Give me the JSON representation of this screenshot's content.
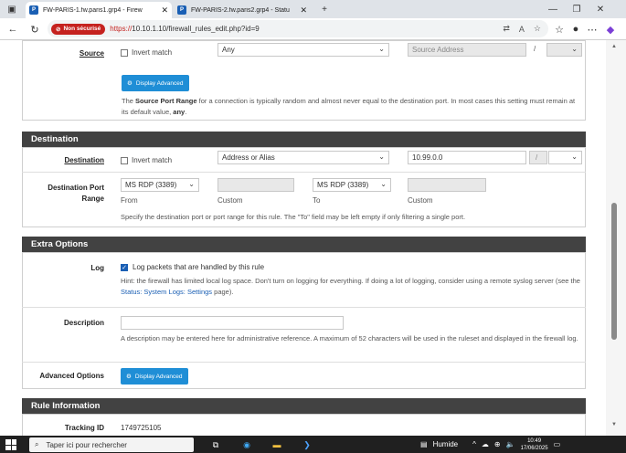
{
  "browser": {
    "tabs": [
      {
        "title": "FW-PARIS-1.fw.paris1.grp4 - Firew",
        "active": true
      },
      {
        "title": "FW-PARIS-2.fw.paris2.grp4 - Statu",
        "active": false
      }
    ],
    "new_tab": "+",
    "security_badge": "Non sécurisé",
    "url_scheme": "https://",
    "url_rest": "10.10.1.10/firewall_rules_edit.php?id=9"
  },
  "source": {
    "label": "Source",
    "invert_label": "Invert match",
    "type_value": "Any",
    "address_placeholder": "Source Address",
    "slash": "/",
    "advanced_button": "Display Advanced",
    "help_pre": "The ",
    "help_bold": "Source Port Range",
    "help_mid": " for a connection is typically random and almost never equal to the destination port. In most cases this setting must remain at its default value, ",
    "help_bold2": "any",
    "help_end": "."
  },
  "destination": {
    "heading": "Destination",
    "label": "Destination",
    "invert_label": "Invert match",
    "type_value": "Address or Alias",
    "address_value": "10.99.0.0",
    "slash": "/",
    "port_label_line1": "Destination Port",
    "port_label_line2": "Range",
    "from_value": "MS RDP (3389)",
    "to_value": "MS RDP (3389)",
    "from_label": "From",
    "custom_label_1": "Custom",
    "to_label": "To",
    "custom_label_2": "Custom",
    "port_help": "Specify the destination port or port range for this rule. The \"To\" field may be left empty if only filtering a single port."
  },
  "extra": {
    "heading": "Extra Options",
    "log_label": "Log",
    "log_checkbox_label": "Log packets that are handled by this rule",
    "log_help_1": "Hint: the firewall has limited local log space. Don't turn on logging for everything. If doing a lot of logging, consider using a remote syslog server (see the ",
    "log_help_link": "Status: System Logs: Settings",
    "log_help_2": " page).",
    "description_label": "Description",
    "description_value": "",
    "description_help": "A description may be entered here for administrative reference. A maximum of 52 characters will be used in the ruleset and displayed in the firewall log.",
    "advanced_label": "Advanced Options",
    "advanced_button": "Display Advanced"
  },
  "rule_info": {
    "heading": "Rule Information",
    "tracking_label": "Tracking ID",
    "tracking_value": "1749725105"
  },
  "taskbar": {
    "search_placeholder": "Taper ici pour rechercher",
    "weather": "Humide",
    "time": "10:49",
    "date": "17/06/2025"
  },
  "colors": {
    "panel_header": "#424242",
    "button_blue": "#1f8ed6",
    "insecure_red": "#c5221f",
    "link": "#1a5fb4"
  }
}
